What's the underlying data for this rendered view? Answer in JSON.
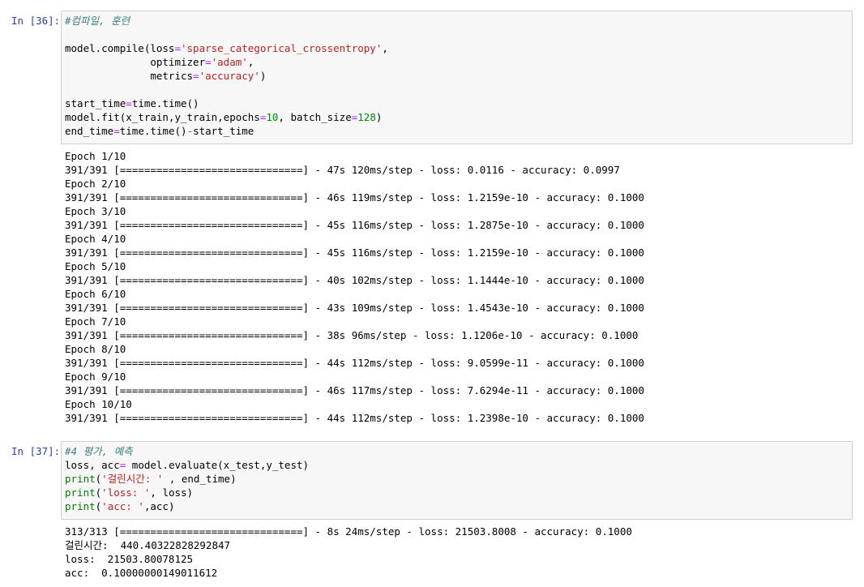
{
  "colors": {
    "prompt": "#303f9f",
    "cell_bg": "#f7f7f7",
    "cell_border": "#cfcfcf",
    "comment": "#408080",
    "string": "#ba2121",
    "number": "#008800",
    "operator": "#aa22ff",
    "builtin": "#008000"
  },
  "cells": [
    {
      "prompt": "In [36]:",
      "code": [
        [
          {
            "t": "#컴파일, 훈련",
            "c": "comment"
          }
        ],
        [],
        [
          {
            "t": "model.compile(loss"
          },
          {
            "t": "=",
            "c": "op"
          },
          {
            "t": "'sparse_categorical_crossentropy'",
            "c": "string"
          },
          {
            "t": ","
          }
        ],
        [
          {
            "t": "              optimizer"
          },
          {
            "t": "=",
            "c": "op"
          },
          {
            "t": "'adam'",
            "c": "string"
          },
          {
            "t": ","
          }
        ],
        [
          {
            "t": "              metrics"
          },
          {
            "t": "=",
            "c": "op"
          },
          {
            "t": "'accuracy'",
            "c": "string"
          },
          {
            "t": ")"
          }
        ],
        [],
        [
          {
            "t": "start_time"
          },
          {
            "t": "=",
            "c": "op"
          },
          {
            "t": "time.time()"
          }
        ],
        [
          {
            "t": "model.fit(x_train,y_train,epochs"
          },
          {
            "t": "=",
            "c": "op"
          },
          {
            "t": "10",
            "c": "number"
          },
          {
            "t": ", batch_size"
          },
          {
            "t": "=",
            "c": "op"
          },
          {
            "t": "128",
            "c": "number"
          },
          {
            "t": ")"
          }
        ],
        [
          {
            "t": "end_time"
          },
          {
            "t": "=",
            "c": "op"
          },
          {
            "t": "time.time()"
          },
          {
            "t": "-",
            "c": "op"
          },
          {
            "t": "start_time"
          }
        ]
      ],
      "output": [
        "Epoch 1/10",
        "391/391 [==============================] - 47s 120ms/step - loss: 0.0116 - accuracy: 0.0997",
        "Epoch 2/10",
        "391/391 [==============================] - 46s 119ms/step - loss: 1.2159e-10 - accuracy: 0.1000",
        "Epoch 3/10",
        "391/391 [==============================] - 45s 116ms/step - loss: 1.2875e-10 - accuracy: 0.1000",
        "Epoch 4/10",
        "391/391 [==============================] - 45s 116ms/step - loss: 1.2159e-10 - accuracy: 0.1000",
        "Epoch 5/10",
        "391/391 [==============================] - 40s 102ms/step - loss: 1.1444e-10 - accuracy: 0.1000",
        "Epoch 6/10",
        "391/391 [==============================] - 43s 109ms/step - loss: 1.4543e-10 - accuracy: 0.1000",
        "Epoch 7/10",
        "391/391 [==============================] - 38s 96ms/step - loss: 1.1206e-10 - accuracy: 0.1000",
        "Epoch 8/10",
        "391/391 [==============================] - 44s 112ms/step - loss: 9.0599e-11 - accuracy: 0.1000",
        "Epoch 9/10",
        "391/391 [==============================] - 46s 117ms/step - loss: 7.6294e-11 - accuracy: 0.1000",
        "Epoch 10/10",
        "391/391 [==============================] - 44s 112ms/step - loss: 1.2398e-10 - accuracy: 0.1000"
      ]
    },
    {
      "prompt": "In [37]:",
      "code": [
        [
          {
            "t": "#4 평가, 예측",
            "c": "comment"
          }
        ],
        [
          {
            "t": "loss, acc"
          },
          {
            "t": "=",
            "c": "op"
          },
          {
            "t": " model.evaluate(x_test,y_test)"
          }
        ],
        [
          {
            "t": "print",
            "c": "builtin"
          },
          {
            "t": "("
          },
          {
            "t": "'걸린시간: '",
            "c": "string"
          },
          {
            "t": " , end_time)"
          }
        ],
        [
          {
            "t": "print",
            "c": "builtin"
          },
          {
            "t": "("
          },
          {
            "t": "'loss: '",
            "c": "string"
          },
          {
            "t": ", loss)"
          }
        ],
        [
          {
            "t": "print",
            "c": "builtin"
          },
          {
            "t": "("
          },
          {
            "t": "'acc: '",
            "c": "string"
          },
          {
            "t": ",acc)"
          }
        ]
      ],
      "output": [
        "313/313 [==============================] - 8s 24ms/step - loss: 21503.8008 - accuracy: 0.1000",
        "걸린시간:  440.40322828292847",
        "loss:  21503.80078125",
        "acc:  0.10000000149011612"
      ]
    }
  ]
}
